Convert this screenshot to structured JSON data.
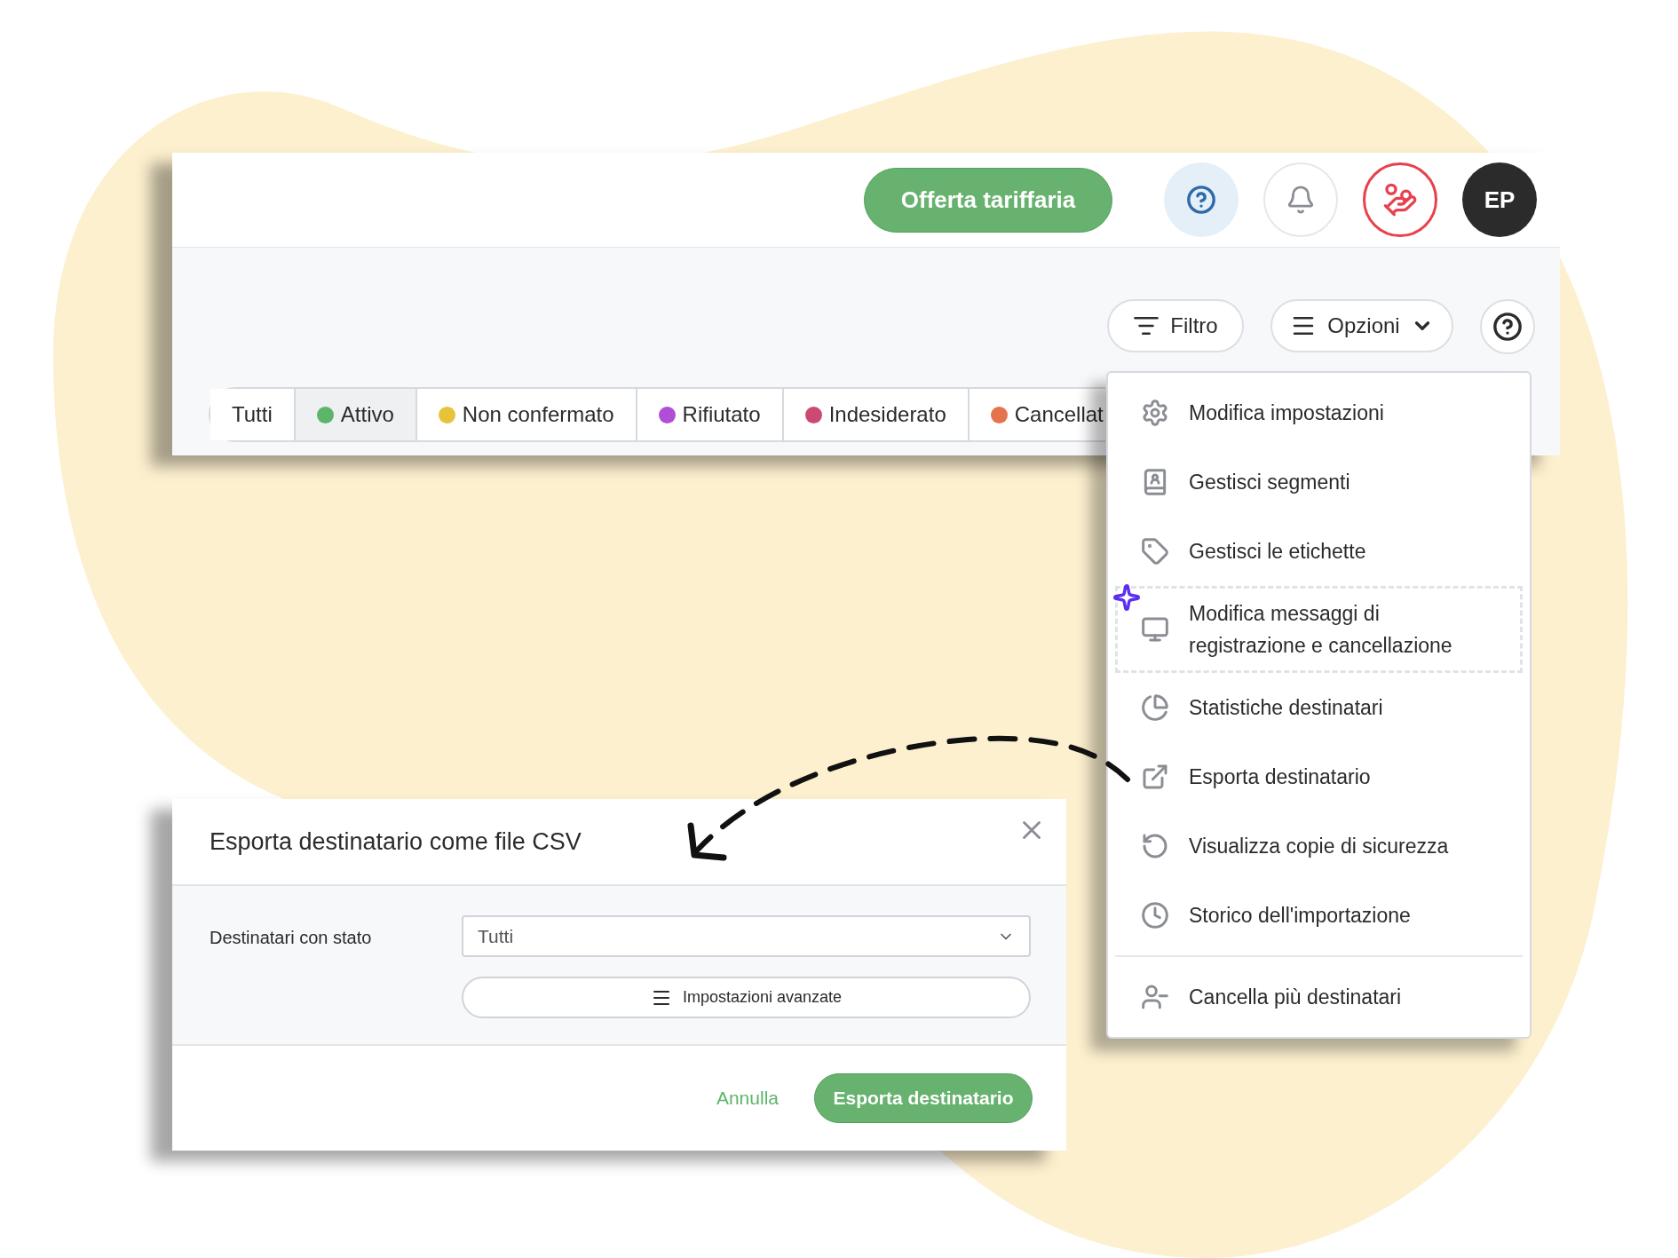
{
  "header": {
    "offer_button": "Offerta tariffaria",
    "avatar": "EP"
  },
  "toolbar": {
    "filter_button": "Filtro",
    "options_button": "Opzioni"
  },
  "status_tabs": [
    {
      "label": "Tutti",
      "selected": false
    },
    {
      "label": "Attivo",
      "selected": true,
      "color": "#5cb56a"
    },
    {
      "label": "Non confermato",
      "selected": false,
      "color": "#e8c33a"
    },
    {
      "label": "Rifiutato",
      "selected": false,
      "color": "#b04fd6"
    },
    {
      "label": "Indesiderato",
      "selected": false,
      "color": "#cc4a72"
    },
    {
      "label": "Cancellat",
      "selected": false,
      "color": "#e5734b"
    }
  ],
  "options_menu": [
    {
      "label": "Modifica impostazioni",
      "highlighted": false
    },
    {
      "label": "Gestisci segmenti",
      "highlighted": false
    },
    {
      "label": "Gestisci le etichette",
      "highlighted": false
    },
    {
      "label": "Modifica messaggi di registrazione e cancellazione",
      "highlighted": true
    },
    {
      "label": "Statistiche destinatari",
      "highlighted": false
    },
    {
      "label": "Esporta destinatario",
      "highlighted": false
    },
    {
      "label": "Visualizza copie di sicurezza",
      "highlighted": false
    },
    {
      "label": "Storico dell'importazione",
      "highlighted": false
    },
    {
      "label": "Cancella più destinatari",
      "highlighted": false,
      "divider_before": true
    }
  ],
  "dialog": {
    "title": "Esporta destinatario come file CSV",
    "field_label": "Destinatari con stato",
    "select_value": "Tutti",
    "advanced_button": "Impostazioni avanzate",
    "cancel_button": "Annulla",
    "confirm_button": "Esporta destinatario"
  }
}
